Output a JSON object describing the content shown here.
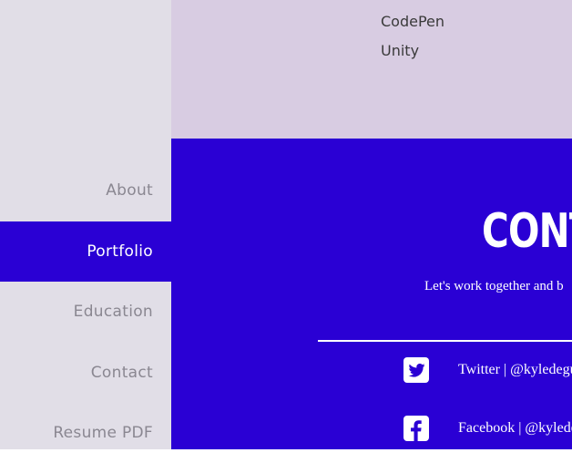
{
  "colors": {
    "sidebar_bg": "#e1dee7",
    "accent": "#2a00d4",
    "skills_bg": "#d8cce2",
    "nav_text": "#8a8791",
    "white": "#ffffff"
  },
  "sidebar": {
    "items": [
      {
        "label": "About",
        "active": false
      },
      {
        "label": "Portfolio",
        "active": true
      },
      {
        "label": "Education",
        "active": false
      },
      {
        "label": "Contact",
        "active": false
      },
      {
        "label": "Resume PDF",
        "active": false
      }
    ]
  },
  "skills": {
    "items": [
      "CodePen",
      "Unity"
    ]
  },
  "contact": {
    "heading": "CONT",
    "tagline": "Let's work together and b",
    "socials": [
      {
        "icon": "twitter-icon",
        "label": "Twitter | @kyledegu"
      },
      {
        "icon": "facebook-icon",
        "label": "Facebook | @kylede"
      }
    ]
  }
}
